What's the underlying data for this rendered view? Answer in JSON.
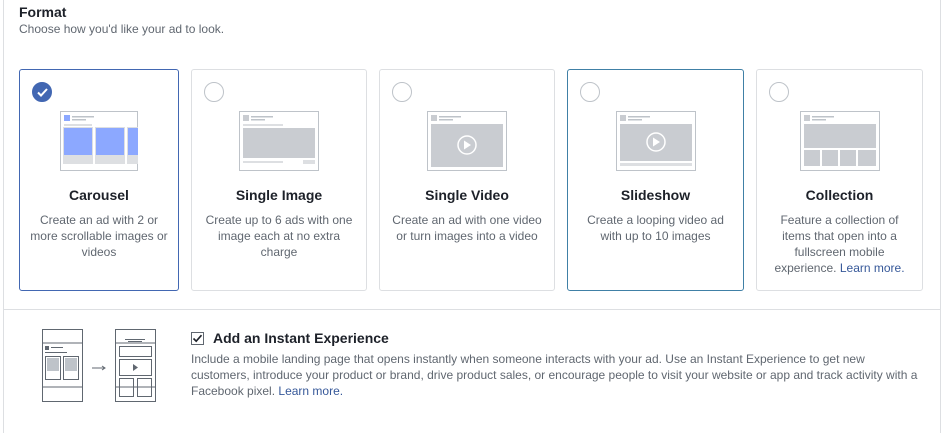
{
  "format": {
    "title": "Format",
    "subtitle": "Choose how you'd like your ad to look."
  },
  "cards": [
    {
      "title": "Carousel",
      "description": "Create an ad with 2 or more scrollable images or videos",
      "selected": true
    },
    {
      "title": "Single Image",
      "description": "Create up to 6 ads with one image each at no extra charge",
      "selected": false
    },
    {
      "title": "Single Video",
      "description": "Create an ad with one video or turn images into a video",
      "selected": false
    },
    {
      "title": "Slideshow",
      "description": "Create a looping video ad with up to 10 images",
      "selected": false
    },
    {
      "title": "Collection",
      "description": "Feature a collection of items that open into a fullscreen mobile experience.",
      "link": "Learn more.",
      "selected": false
    }
  ],
  "instant_experience": {
    "checked": true,
    "title": "Add an Instant Experience",
    "description": "Include a mobile landing page that opens instantly when someone interacts with your ad. Use an Instant Experience to get new customers, introduce your product or brand, drive product sales, or encourage people to visit your website or app and track activity with a Facebook pixel.",
    "link": "Learn more."
  },
  "colors": {
    "accent": "#4267b2",
    "carousel_image": "#8ca8ff",
    "placeholder": "#c9ccd1",
    "link": "#365899"
  }
}
